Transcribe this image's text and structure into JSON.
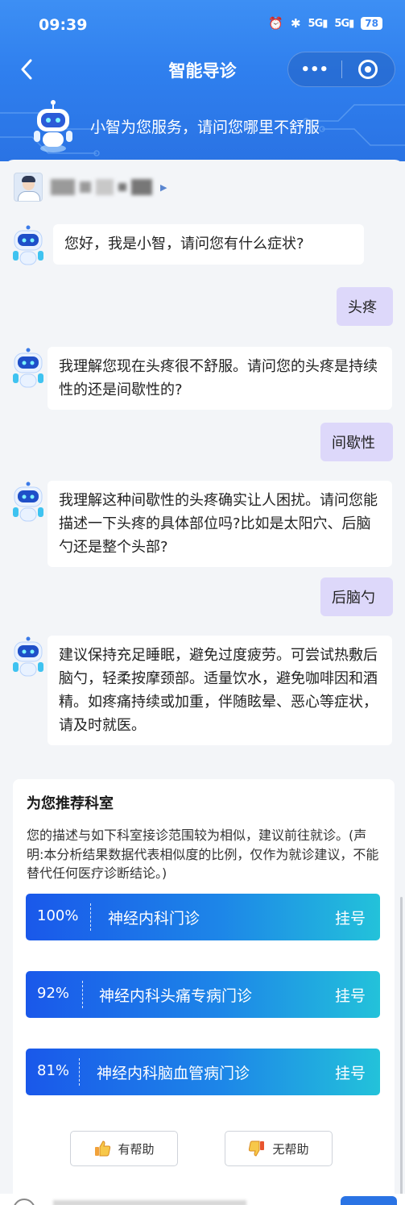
{
  "status_bar": {
    "time": "09:39",
    "network_1": "5G",
    "network_2": "5G",
    "battery": "78"
  },
  "nav": {
    "title": "智能导诊",
    "more_label": "•••"
  },
  "banner": {
    "text": "小智为您服务，请问您哪里不舒服"
  },
  "chat": {
    "bot_greeting": "您好，我是小智，请问您有什么症状?",
    "user_1": "头疼",
    "bot_2": "我理解您现在头疼很不舒服。请问您的头疼是持续性的还是间歇性的?",
    "user_2": "间歇性",
    "bot_3": "我理解这种间歇性的头疼确实让人困扰。请问您能描述一下头疼的具体部位吗?比如是太阳穴、后脑勺还是整个头部?",
    "user_3": "后脑勺",
    "bot_4": "建议保持充足睡眠，避免过度疲劳。可尝试热敷后脑勺，轻柔按摩颈部。适量饮水，避免咖啡因和酒精。如疼痛持续或加重，伴随眩晕、恶心等症状，请及时就医。"
  },
  "recommend": {
    "title": "为您推荐科室",
    "description": "您的描述与如下科室接诊范围较为相似，建议前往就诊。(声明:本分析结果数据代表相似度的比例，仅作为就诊建议，不能替代任何医疗诊断结论。)",
    "departments": [
      {
        "percent": "100%",
        "name": "神经内科门诊",
        "action": "挂号"
      },
      {
        "percent": "92%",
        "name": "神经内科头痛专病门诊",
        "action": "挂号"
      },
      {
        "percent": "81%",
        "name": "神经内科脑血管病门诊",
        "action": "挂号"
      }
    ],
    "helpful": "有帮助",
    "not_helpful": "无帮助"
  },
  "colors": {
    "header_blue": "#3d8ff4",
    "user_bubble": "#ddd8fa",
    "dept_gradient_start": "#1a58ea",
    "dept_gradient_end": "#23c2da"
  }
}
